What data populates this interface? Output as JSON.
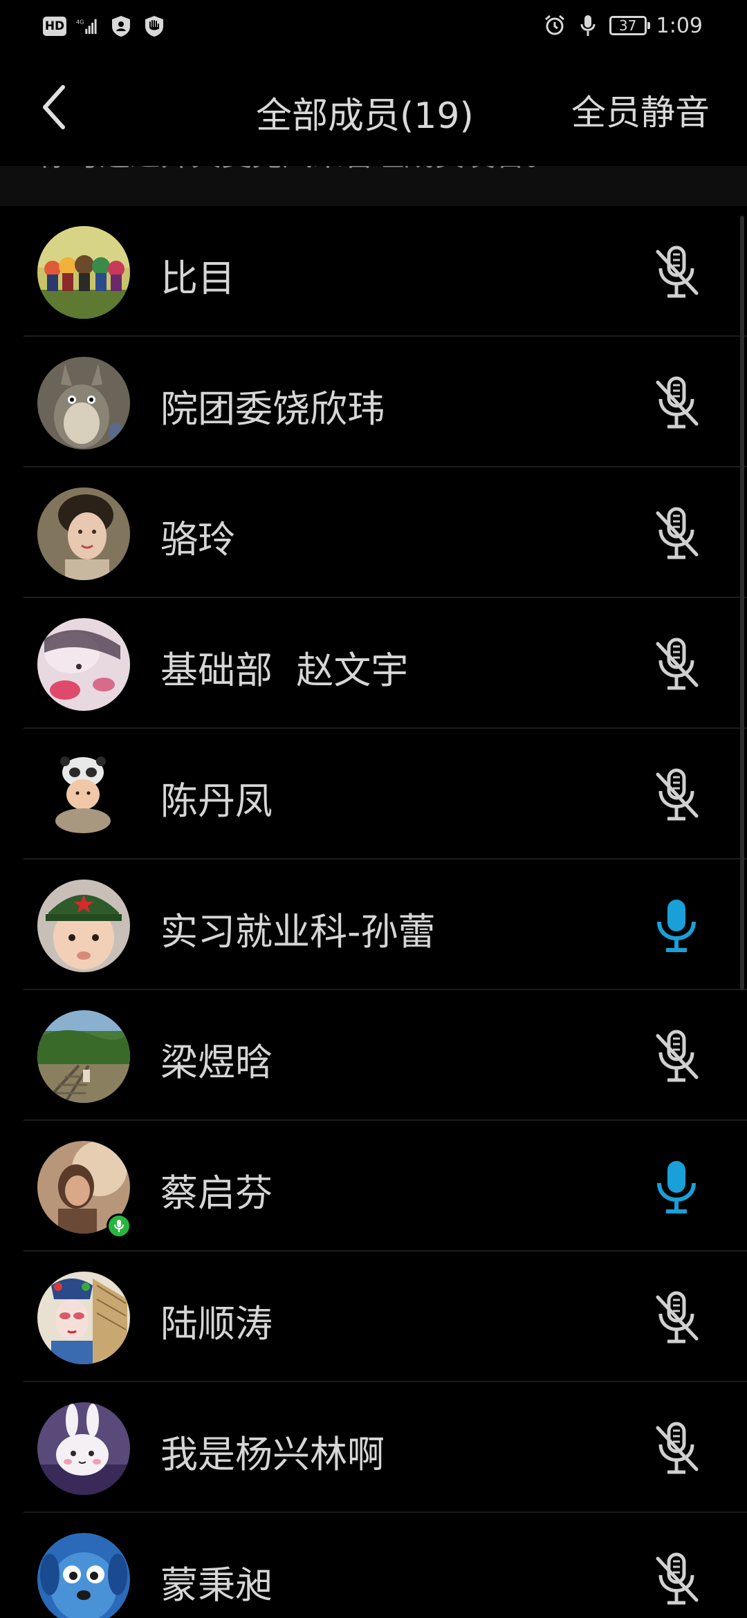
{
  "status_bar": {
    "hd": "HD",
    "network": "4G",
    "battery": "37",
    "time": "1:09"
  },
  "header": {
    "title": "全部成员(19)",
    "mute_all_label": "全员静音"
  },
  "notice": {
    "text": "你可通过开关麦克风来管理成员发言。"
  },
  "colors": {
    "mic_active": "#1aa0d8",
    "mic_muted": "#d0d0d0",
    "speaking_badge": "#27b53f"
  },
  "members": [
    {
      "name": "比目",
      "mic": "muted",
      "avatar_icon": "cartoon-crowd-avatar"
    },
    {
      "name": "院团委饶欣玮",
      "mic": "muted",
      "avatar_icon": "totoro-avatar"
    },
    {
      "name": "骆玲",
      "mic": "muted",
      "avatar_icon": "portrait-avatar"
    },
    {
      "name": "基础部  赵文宇",
      "mic": "muted",
      "avatar_icon": "pink-art-avatar"
    },
    {
      "name": "陈丹凤",
      "mic": "muted",
      "avatar_icon": "baby-panda-hat-avatar"
    },
    {
      "name": "实习就业科-孙蕾",
      "mic": "active",
      "avatar_icon": "baby-army-cap-avatar"
    },
    {
      "name": "梁煜晗",
      "mic": "muted",
      "avatar_icon": "railway-landscape-avatar"
    },
    {
      "name": "蔡启芬",
      "mic": "active",
      "avatar_icon": "sunlit-girl-avatar",
      "speaking": true
    },
    {
      "name": "陆顺涛",
      "mic": "muted",
      "avatar_icon": "opera-mask-avatar"
    },
    {
      "name": "我是杨兴林啊",
      "mic": "muted",
      "avatar_icon": "rabbit-avatar"
    },
    {
      "name": "蒙秉昶",
      "mic": "muted",
      "avatar_icon": "blue-dog-avatar"
    }
  ]
}
